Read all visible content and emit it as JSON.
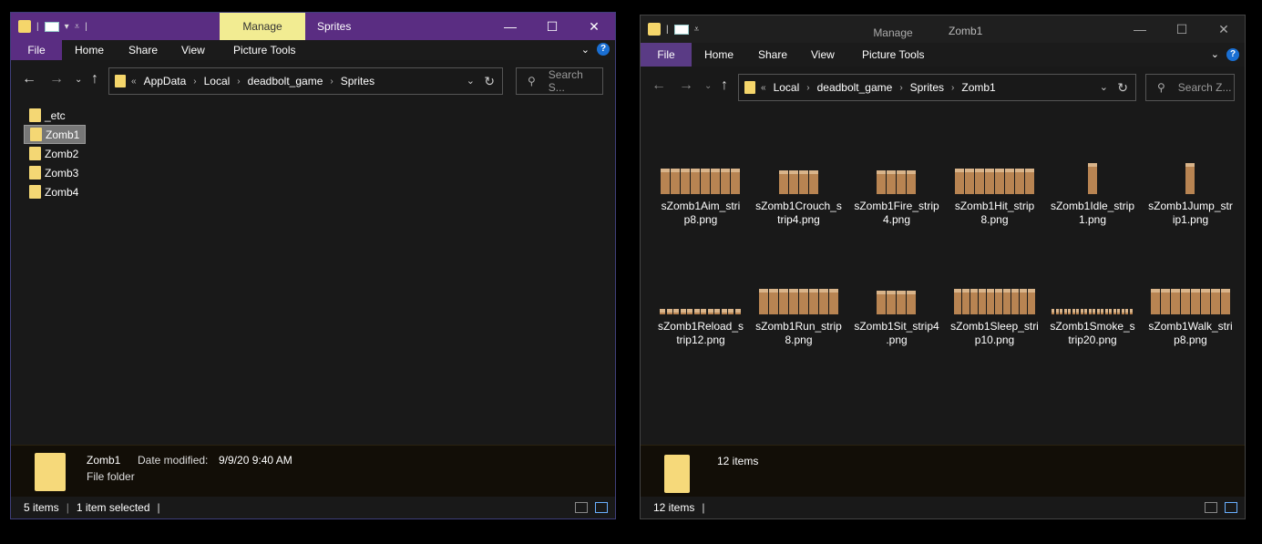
{
  "left": {
    "ribbon_context_tab": "Manage",
    "title": "Sprites",
    "tabs": [
      "File",
      "Home",
      "Share",
      "View",
      "Picture Tools"
    ],
    "breadcrumb": [
      "AppData",
      "Local",
      "deadbolt_game",
      "Sprites"
    ],
    "breadcrumb_prefix": "«",
    "search_placeholder": "Search S...",
    "folders": [
      "_etc",
      "Zomb1",
      "Zomb2",
      "Zomb3",
      "Zomb4"
    ],
    "selected_folder": "Zomb1",
    "details": {
      "name": "Zomb1",
      "modified_label": "Date modified:",
      "modified_value": "9/9/20 9:40 AM",
      "type": "File folder"
    },
    "status": {
      "count": "5 items",
      "selected": "1 item selected"
    }
  },
  "right": {
    "ribbon_context_tab": "Manage",
    "title": "Zomb1",
    "tabs": [
      "File",
      "Home",
      "Share",
      "View",
      "Picture Tools"
    ],
    "breadcrumb": [
      "Local",
      "deadbolt_game",
      "Sprites",
      "Zomb1"
    ],
    "breadcrumb_prefix": "«",
    "search_placeholder": "Search Z...",
    "files": [
      {
        "line1": "sZomb1Aim_stri",
        "line2": "p8.png",
        "frames": 8
      },
      {
        "line1": "sZomb1Crouch_s",
        "line2": "trip4.png",
        "frames": 4
      },
      {
        "line1": "sZomb1Fire_strip",
        "line2": "4.png",
        "frames": 4
      },
      {
        "line1": "sZomb1Hit_strip",
        "line2": "8.png",
        "frames": 8
      },
      {
        "line1": "sZomb1Idle_strip",
        "line2": "1.png",
        "frames": 1
      },
      {
        "line1": "sZomb1Jump_str",
        "line2": "ip1.png",
        "frames": 1
      },
      {
        "line1": "sZomb1Reload_s",
        "line2": "trip12.png",
        "frames": 12
      },
      {
        "line1": "sZomb1Run_strip",
        "line2": "8.png",
        "frames": 8
      },
      {
        "line1": "sZomb1Sit_strip4",
        "line2": ".png",
        "frames": 4
      },
      {
        "line1": "sZomb1Sleep_stri",
        "line2": "p10.png",
        "frames": 10
      },
      {
        "line1": "sZomb1Smoke_s",
        "line2": "trip20.png",
        "frames": 20
      },
      {
        "line1": "sZomb1Walk_stri",
        "line2": "p8.png",
        "frames": 8
      }
    ],
    "details": {
      "count": "12 items"
    },
    "status": {
      "count": "12 items"
    }
  },
  "colors": {
    "purple_title": "#5a2d82",
    "manage_tab": "#f2ec92",
    "folder": "#f5d66b"
  }
}
